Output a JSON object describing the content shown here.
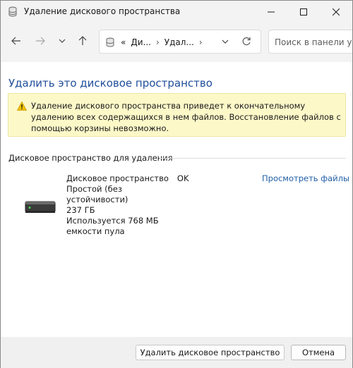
{
  "window": {
    "title": "Удаление дискового пространства"
  },
  "address_bar": {
    "crumbs": [
      "«",
      "Ди...",
      "›",
      "Удал...",
      "›"
    ],
    "search_placeholder": "Поиск в панели управления"
  },
  "main": {
    "heading": "Удалить это дисковое пространство",
    "warning_text": "Удаление дискового пространства приведет к окончательному удалению всех содержащихся в нем файлов. Восстановление файлов с помощью корзины невозможно.",
    "section_title": "Дисковое пространство для удаления",
    "space": {
      "name": "Дисковое пространство",
      "status": "OK",
      "resiliency": "Простой (без устойчивости)",
      "size": "237 ГБ",
      "usage": "Используется 768 МБ емкости пула"
    },
    "view_files_link": "Просмотреть файлы"
  },
  "footer": {
    "delete_button": "Удалить дисковое пространство",
    "cancel_button": "Отмена"
  },
  "colors": {
    "heading": "#1f4e9a",
    "link": "#1f5fa8",
    "warning_bg": "#fdf8c8",
    "ok_green": "#2e9a3a"
  },
  "icons": [
    "storage-spaces-icon",
    "minimize-icon",
    "maximize-icon",
    "close-icon",
    "back-arrow-icon",
    "forward-arrow-icon",
    "recent-dropdown-icon",
    "up-arrow-icon",
    "chevron-down-icon",
    "refresh-icon",
    "warning-icon",
    "ok-check-icon",
    "drive-icon"
  ]
}
